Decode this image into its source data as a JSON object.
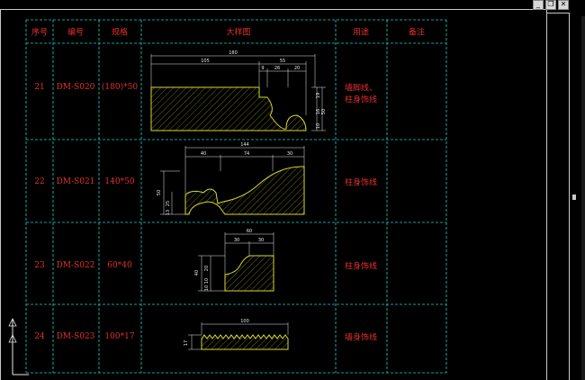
{
  "window": {
    "buttons": {
      "minimize": "_",
      "restore": "❐",
      "close": "✕"
    }
  },
  "table": {
    "headers": {
      "seq": "序号",
      "code": "编号",
      "spec": "规格",
      "sample": "大样图",
      "usage": "用途",
      "note": "备注"
    },
    "rows": [
      {
        "seq": "21",
        "code": "DM-S020",
        "spec": "(180)*50",
        "usage_line1": "墙脚线、",
        "usage_line2": "柱身饰线",
        "note": ""
      },
      {
        "seq": "22",
        "code": "DM-S021",
        "spec": "140*50",
        "usage_line1": "柱身饰线",
        "usage_line2": "",
        "note": ""
      },
      {
        "seq": "23",
        "code": "DM-S022",
        "spec": "60*40",
        "usage_line1": "柱身饰线",
        "usage_line2": "",
        "note": ""
      },
      {
        "seq": "24",
        "code": "DM-S023",
        "spec": "100*17",
        "usage_line1": "墙身饰线",
        "usage_line2": "",
        "note": ""
      }
    ]
  },
  "dims": {
    "p21": {
      "total": "180",
      "a": "105",
      "b": "55",
      "c": "9",
      "d": "26",
      "e": "20",
      "v1": "50",
      "v2": "19",
      "v3": "16",
      "v4": "10"
    },
    "p22": {
      "total": "144",
      "a": "40",
      "b": "74",
      "c": "30",
      "v1": "50",
      "v2": "25",
      "v3": "13"
    },
    "p23": {
      "total": "60",
      "a": "30",
      "b": "30",
      "v1": "40",
      "v2": "20",
      "v3": "10",
      "v4": "10"
    },
    "p24": {
      "total": "100",
      "v1": "17"
    }
  },
  "colors": {
    "grid": "#1ad0d0",
    "profile": "#d8d830",
    "text_red": "#e23030",
    "dim": "#e8e8e8"
  }
}
